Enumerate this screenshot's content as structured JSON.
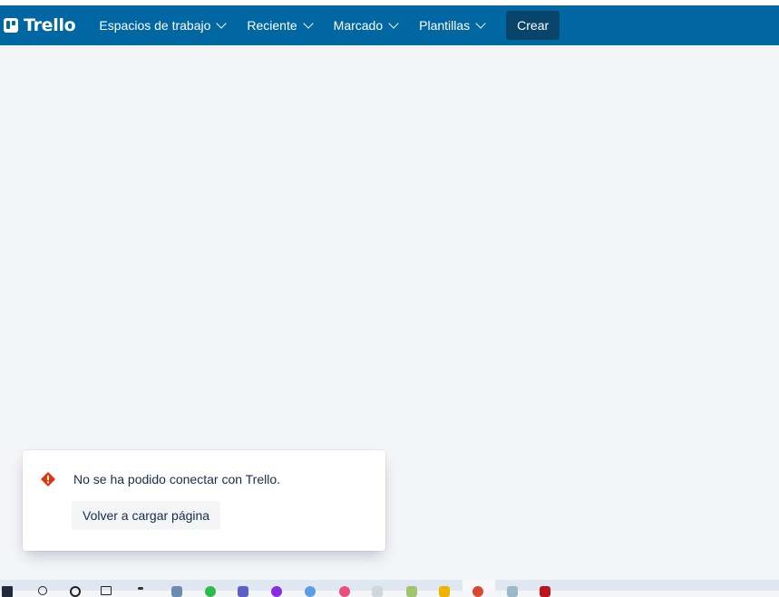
{
  "app": {
    "name": "Trello",
    "brand_color": "#0067a3"
  },
  "nav": {
    "items": [
      {
        "label": "Espacios de trabajo",
        "icon": "chevron-down-icon"
      },
      {
        "label": "Reciente",
        "icon": "chevron-down-icon"
      },
      {
        "label": "Marcado",
        "icon": "chevron-down-icon"
      },
      {
        "label": "Plantillas",
        "icon": "chevron-down-icon"
      }
    ],
    "create_label": "Crear"
  },
  "toast": {
    "icon": "warning-icon",
    "icon_color": "#de350b",
    "message": "No se ha podido conectar con Trello.",
    "reload_label": "Volver a cargar página"
  },
  "taskbar": {
    "icons": [
      "windows-start-icon",
      "search-icon",
      "cortana-icon",
      "task-view-icon",
      "app-icon",
      "app-icon",
      "app-icon",
      "app-icon",
      "app-icon",
      "app-icon",
      "app-icon",
      "app-icon",
      "app-icon",
      "app-icon",
      "browser-icon",
      "app-icon",
      "app-icon"
    ]
  }
}
